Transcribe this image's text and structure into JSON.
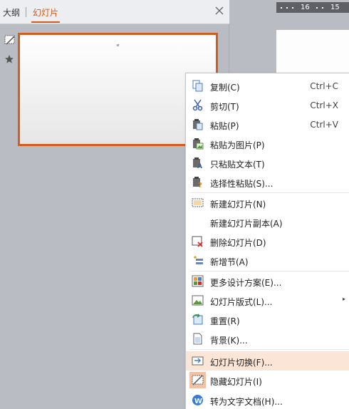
{
  "panel": {
    "tabs": [
      {
        "label": "大纲"
      },
      {
        "label": "幻灯片"
      }
    ],
    "close_icon": "close-icon",
    "slide": {
      "number_icon": "slide-number-icon",
      "star_icon": "star-icon",
      "thumbnail_text": "ııı"
    }
  },
  "ruler": {
    "marks": [
      "16",
      "15"
    ]
  },
  "menu": {
    "items": [
      {
        "label": "复制(C)",
        "shortcut": "Ctrl+C",
        "icon": "copy-icon"
      },
      {
        "label": "剪切(T)",
        "shortcut": "Ctrl+X",
        "icon": "cut-icon"
      },
      {
        "label": "粘贴(P)",
        "shortcut": "Ctrl+V",
        "icon": "paste-icon"
      },
      {
        "label": "粘贴为图片(P)",
        "shortcut": "",
        "icon": "paste-as-picture-icon"
      },
      {
        "label": "只粘贴文本(T)",
        "shortcut": "",
        "icon": "paste-text-only-icon"
      },
      {
        "label": "选择性粘贴(S)...",
        "shortcut": "",
        "icon": "paste-special-icon"
      },
      {
        "label": "新建幻灯片(N)",
        "shortcut": "",
        "icon": "new-slide-icon"
      },
      {
        "label": "新建幻灯片副本(A)",
        "shortcut": "",
        "icon": ""
      },
      {
        "label": "删除幻灯片(D)",
        "shortcut": "",
        "icon": "delete-slide-icon"
      },
      {
        "label": "新增节(A)",
        "shortcut": "",
        "icon": "new-section-icon"
      },
      {
        "label": "更多设计方案(E)...",
        "shortcut": "",
        "icon": "design-icon"
      },
      {
        "label": "幻灯片版式(L)...",
        "shortcut": "",
        "icon": "layout-icon"
      },
      {
        "label": "重置(R)",
        "shortcut": "",
        "icon": "reset-icon"
      },
      {
        "label": "背景(K)...",
        "shortcut": "",
        "icon": "background-icon"
      },
      {
        "label": "幻灯片切换(F)...",
        "shortcut": "",
        "icon": "slide-transition-icon"
      },
      {
        "label": "隐藏幻灯片(I)",
        "shortcut": "",
        "icon": "hide-slide-icon"
      },
      {
        "label": "转为文字文档(H)...",
        "shortcut": "",
        "icon": "convert-document-icon"
      }
    ],
    "highlighted_index": 14,
    "submenu_arrow_item": 11,
    "colors": {
      "accent": "#d25d1f",
      "highlight": "#fbe5d6"
    }
  }
}
